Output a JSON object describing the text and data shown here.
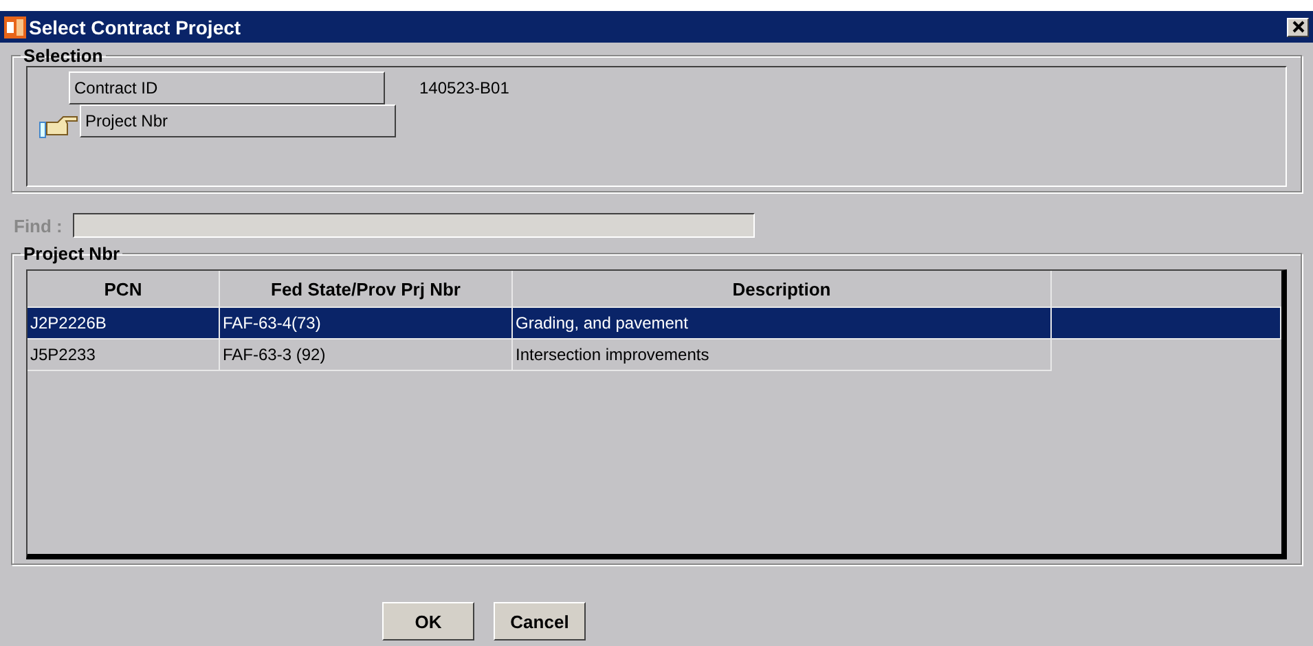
{
  "window": {
    "title": "Select Contract Project"
  },
  "selection": {
    "title": "Selection",
    "fields": [
      {
        "label": "Contract ID",
        "value": "140523-B01",
        "current": false
      },
      {
        "label": "Project Nbr",
        "current": true
      }
    ]
  },
  "find": {
    "label": "Find :",
    "disabled": true
  },
  "projects": {
    "title": "Project Nbr",
    "columns": [
      "PCN",
      "Fed State/Prov Prj Nbr",
      "Description"
    ],
    "rows": [
      {
        "cells": [
          "J2P2226B",
          "FAF-63-4(73)",
          "Grading, and pavement"
        ],
        "selected": true
      },
      {
        "cells": [
          "J5P2233",
          "FAF-63-3 (92)",
          "Intersection improvements"
        ],
        "selected": false
      }
    ]
  },
  "buttons": [
    "OK",
    "Cancel"
  ]
}
